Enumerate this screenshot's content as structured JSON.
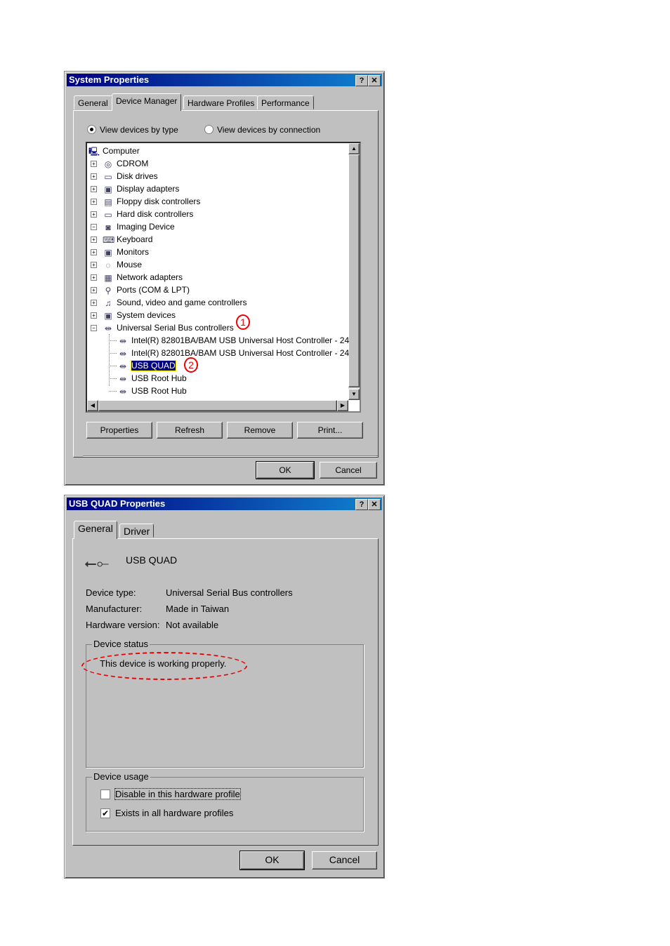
{
  "sysprops": {
    "title": "System Properties",
    "help": "?",
    "close": "✕",
    "tabs": [
      "General",
      "Device Manager",
      "Hardware Profiles",
      "Performance"
    ],
    "radio_type": "View devices by type",
    "radio_connection": "View devices by connection",
    "tree": [
      {
        "label": "Computer",
        "icon": "computer-icon",
        "level": 0
      },
      {
        "label": "CDROM",
        "icon": "cdrom-icon",
        "level": 1,
        "pm": "+"
      },
      {
        "label": "Disk drives",
        "icon": "disk-icon",
        "level": 1,
        "pm": "+"
      },
      {
        "label": "Display adapters",
        "icon": "display-icon",
        "level": 1,
        "pm": "+"
      },
      {
        "label": "Floppy disk controllers",
        "icon": "floppy-icon",
        "level": 1,
        "pm": "+"
      },
      {
        "label": "Hard disk controllers",
        "icon": "harddisk-icon",
        "level": 1,
        "pm": "+"
      },
      {
        "label": "Imaging Device",
        "icon": "camera-icon",
        "level": 1,
        "pm": "-"
      },
      {
        "label": "Keyboard",
        "icon": "keyboard-icon",
        "level": 1,
        "pm": "+"
      },
      {
        "label": "Monitors",
        "icon": "monitor-icon",
        "level": 1,
        "pm": "+"
      },
      {
        "label": "Mouse",
        "icon": "mouse-icon",
        "level": 1,
        "pm": "+"
      },
      {
        "label": "Network adapters",
        "icon": "network-icon",
        "level": 1,
        "pm": "+"
      },
      {
        "label": "Ports (COM & LPT)",
        "icon": "port-icon",
        "level": 1,
        "pm": "+"
      },
      {
        "label": "Sound, video and game controllers",
        "icon": "sound-icon",
        "level": 1,
        "pm": "+"
      },
      {
        "label": "System devices",
        "icon": "system-icon",
        "level": 1,
        "pm": "+"
      },
      {
        "label": "Universal Serial Bus controllers",
        "icon": "usb-icon",
        "level": 1,
        "pm": "-"
      },
      {
        "label": "Intel(R) 82801BA/BAM USB Universal Host Controller - 24",
        "icon": "usb-icon",
        "level": 2
      },
      {
        "label": "Intel(R) 82801BA/BAM USB Universal Host Controller - 24",
        "icon": "usb-icon",
        "level": 2
      },
      {
        "label": "USB QUAD",
        "icon": "usb-icon",
        "level": 2,
        "selected": true
      },
      {
        "label": "USB Root Hub",
        "icon": "usb-icon",
        "level": 2
      },
      {
        "label": "USB Root Hub",
        "icon": "usb-icon",
        "level": 2
      }
    ],
    "annot1": "1",
    "annot2": "2",
    "buttons": [
      "Properties",
      "Refresh",
      "Remove",
      "Print..."
    ],
    "ok": "OK",
    "cancel": "Cancel"
  },
  "usbprops": {
    "title": "USB QUAD Properties",
    "help": "?",
    "close": "✕",
    "tabs": [
      "General",
      "Driver"
    ],
    "device_name": "USB QUAD",
    "fields": [
      {
        "label": "Device type:",
        "value": "Universal Serial Bus controllers"
      },
      {
        "label": "Manufacturer:",
        "value": "Made in Taiwan"
      },
      {
        "label": "Hardware version:",
        "value": "Not available"
      }
    ],
    "status_legend": "Device status",
    "status_text": "This device is working properly.",
    "usage_legend": "Device usage",
    "disable_label": "Disable in this hardware profile",
    "disable_checked": false,
    "exists_label": "Exists in all hardware profiles",
    "exists_checked": true,
    "ok": "OK",
    "cancel": "Cancel"
  },
  "colors": {
    "titlebar": "#000080",
    "annotation": "#e00000",
    "selection": "#000080"
  }
}
